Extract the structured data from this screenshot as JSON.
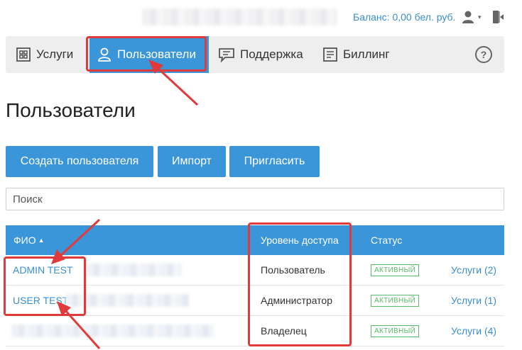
{
  "topbar": {
    "balance": "Баланс: 0,00 бел. руб.",
    "caret": "▾"
  },
  "nav": {
    "items": [
      {
        "label": "Услуги",
        "icon": "services-grid-icon"
      },
      {
        "label": "Пользователи",
        "icon": "user-outline-icon"
      },
      {
        "label": "Поддержка",
        "icon": "chat-bubble-icon"
      },
      {
        "label": "Биллинг",
        "icon": "billing-document-icon"
      }
    ],
    "active": "Пользователи",
    "help_icon": "help-circle-icon"
  },
  "page": {
    "title": "Пользователи"
  },
  "toolbar": {
    "create_label": "Создать пользователя",
    "import_label": "Импорт",
    "invite_label": "Пригласить"
  },
  "search": {
    "placeholder": "Поиск"
  },
  "table": {
    "headers": {
      "name": "ФИО",
      "sort_indicator": "▲",
      "access": "Уровень доступа",
      "status": "Статус"
    },
    "rows": [
      {
        "name": "ADMIN TEST",
        "access": "Пользователь",
        "status": "АКТИВНЫЙ",
        "services": "Услуги (2)"
      },
      {
        "name": "USER TEST",
        "access": "Администратор",
        "status": "АКТИВНЫЙ",
        "services": "Услуги (1)"
      },
      {
        "name": "",
        "access": "Владелец",
        "status": "АКТИВНЫЙ",
        "services": "Услуги (4)"
      }
    ]
  },
  "colors": {
    "accent": "#3a96d9",
    "link": "#3a8fd0",
    "status_active": "#5cb86c",
    "annotation": "#e03a3a",
    "nav_bg": "#eeeeef"
  }
}
